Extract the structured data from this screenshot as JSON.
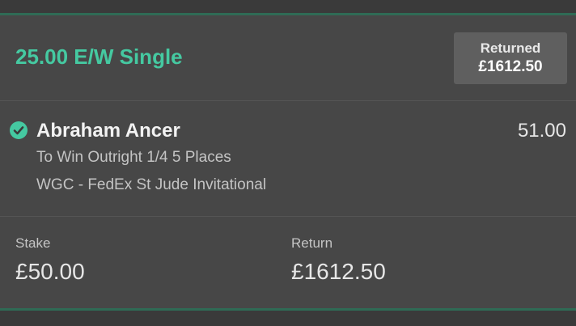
{
  "bet": {
    "title": "25.00 E/W Single",
    "returned_label": "Returned",
    "returned_value": "£1612.50"
  },
  "selection": {
    "status_icon": "check-circle-icon",
    "runner": "Abraham Ancer",
    "odds": "51.00",
    "market": "To Win Outright 1/4 5 Places",
    "event": "WGC - FedEx St Jude Invitational"
  },
  "summary": {
    "stake_label": "Stake",
    "stake_value": "£50.00",
    "return_label": "Return",
    "return_value": "£1612.50"
  },
  "colors": {
    "accent": "#45c9a1",
    "divider": "#2f6b55",
    "card_bg": "#474747",
    "page_bg": "#3a3a3a"
  }
}
